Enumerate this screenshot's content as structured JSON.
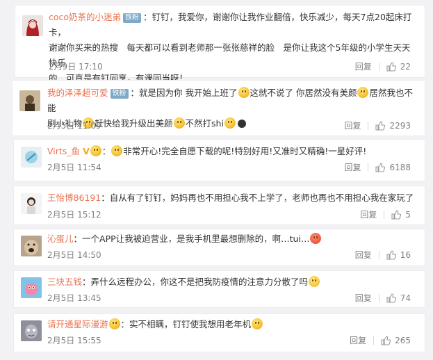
{
  "ui": {
    "reply_label": "回复"
  },
  "comments": [
    {
      "user": "coco奶茶的小迷弟",
      "badge": "铁粉",
      "lines": [
        "：钉钉，我爱你，谢谢你让我作业翻倍，快乐减少，每天7点20起床打卡，",
        "谢谢你买来的热搜　每天都可以看到老师那一张张慈祥的脸　是你让我这个5年级的小学生天天快乐",
        "的　可真是有钉同享，有课同当呀！"
      ],
      "date": "2月9日 17:10",
      "likes": "22"
    },
    {
      "user": "我的泽泽超可爱",
      "badge": "铁粉",
      "seg1": "：就是因为你 我开始上班了",
      "seg2": "这就不说了 你居然没有美颜",
      "seg3": "居然我也不能",
      "seg4": "刷小礼物",
      "seg5": "赶快给我升级出美颜",
      "seg6": "不然打shi",
      "date": "2月5日 11:09",
      "likes": "2293"
    },
    {
      "user": "Virts_鱼",
      "seg1": "：",
      "seg2": "非常开心!完全自愿下载的呢!特别好用!又准时又精确!一星好评!",
      "date": "2月5日 11:54",
      "likes": "6188"
    },
    {
      "user": "王怡博86191",
      "text": "：自从有了钉钉，妈妈再也不用担心我不上学了，老师也再也不用担心我在家玩了",
      "date": "2月5日 15:12",
      "likes": "5"
    },
    {
      "user": "沁蛋儿",
      "text": "：一个APP让我被迫营业，是我手机里最想删除的，啊…tui…",
      "date": "2月5日 14:50",
      "likes": "16"
    },
    {
      "user": "三块五钱",
      "text": "：弄什么远程办公，你这不是把我防疫情的注意力分散了吗",
      "date": "2月5日 13:45",
      "likes": "74"
    },
    {
      "user": "请开通星际漫游",
      "text": "：实不相瞒，钉钉使我想用老年机",
      "date": "2月5日 15:55",
      "likes": "265"
    }
  ]
}
